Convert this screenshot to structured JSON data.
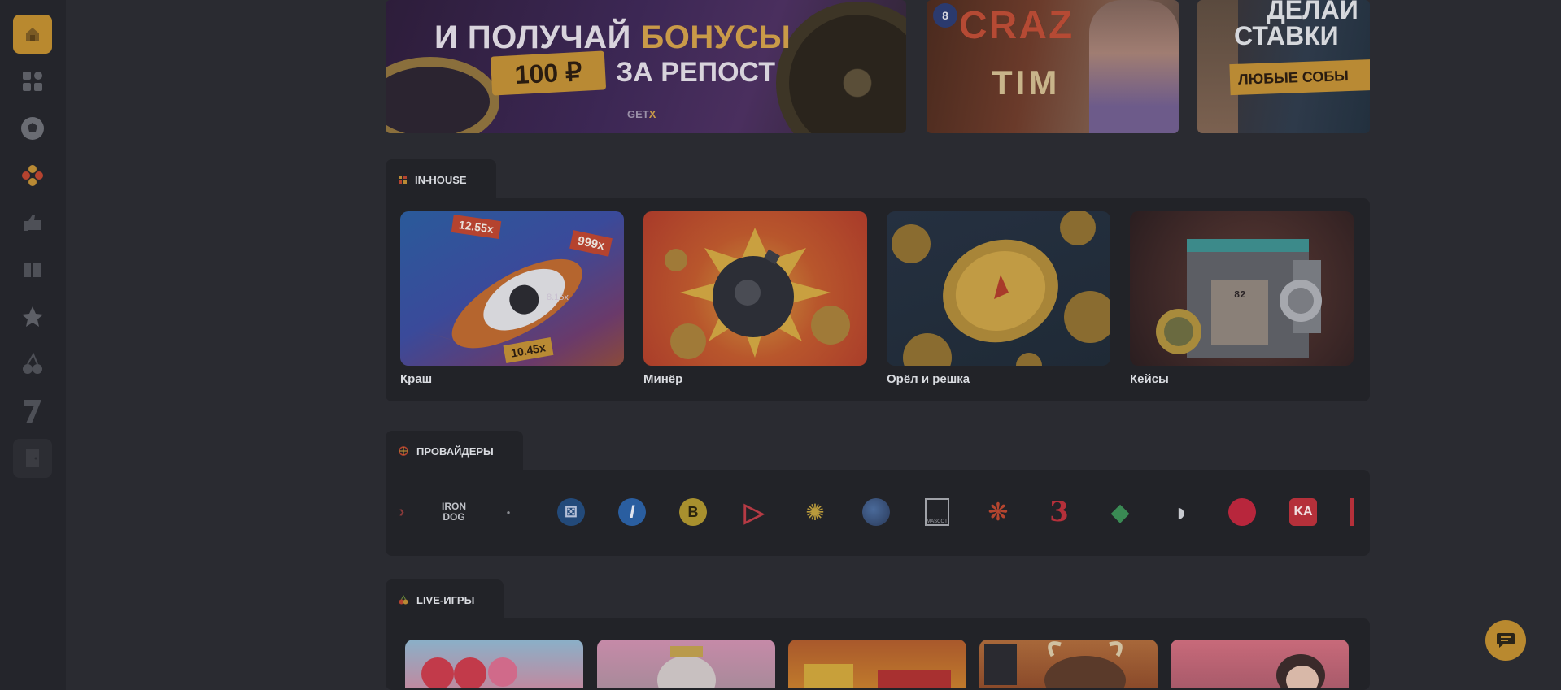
{
  "sidebar": {
    "items": [
      {
        "name": "home",
        "icon": "home-icon"
      },
      {
        "name": "categories",
        "icon": "grid-icon"
      },
      {
        "name": "sports",
        "icon": "soccer-ball-icon"
      },
      {
        "name": "games",
        "icon": "flower-icon"
      },
      {
        "name": "popular",
        "icon": "thumbs-up-icon"
      },
      {
        "name": "book",
        "icon": "book-icon"
      },
      {
        "name": "favorites",
        "icon": "star-icon"
      },
      {
        "name": "slots",
        "icon": "cherries-icon"
      },
      {
        "name": "sevens",
        "icon": "seven-icon"
      },
      {
        "name": "exit",
        "icon": "door-icon"
      }
    ]
  },
  "banners": {
    "promo1": {
      "line1_white": "И ПОЛУЧАЙ ",
      "line1_accent": "БОНУСЫ",
      "amount": "100 ₽",
      "line2": "ЗА РЕПОСТ",
      "brand_main": "GET",
      "brand_accent": "X"
    },
    "promo2": {
      "title": "CRAZ",
      "subtitle": "TIM",
      "ball": "8"
    },
    "promo3": {
      "line1": "ДЕЛАЙ",
      "line2": "СТАВКИ",
      "tag": "ЛЮБЫЕ СОБЫ"
    }
  },
  "inhouse": {
    "title": "IN-HOUSE",
    "games": [
      {
        "label": "Краш",
        "tags": [
          "12.55x",
          "999x",
          "8.15x",
          "10.45x"
        ]
      },
      {
        "label": "Минёр"
      },
      {
        "label": "Орёл и решка"
      },
      {
        "label": "Кейсы",
        "counter": "82"
      }
    ]
  },
  "providers": {
    "title": "ПРОВАЙДЕРЫ",
    "logos": [
      {
        "name": "partial-left",
        "text": "›"
      },
      {
        "name": "iron-dog",
        "text": "IRON DOG"
      },
      {
        "name": "small-logo",
        "text": "●"
      },
      {
        "name": "dice",
        "text": "⚄"
      },
      {
        "name": "i-logo",
        "text": "I"
      },
      {
        "name": "b-logo",
        "text": "B"
      },
      {
        "name": "play-logo",
        "text": "▷"
      },
      {
        "name": "sun-logo",
        "text": "✺"
      },
      {
        "name": "globe-logo",
        "text": "●"
      },
      {
        "name": "mascot",
        "text": "MASCOT"
      },
      {
        "name": "tree-logo",
        "text": "❋"
      },
      {
        "name": "three-logo",
        "text": "3"
      },
      {
        "name": "diamond-logo",
        "text": "◆"
      },
      {
        "name": "pac-logo",
        "text": "◗"
      },
      {
        "name": "red-dot",
        "text": ""
      },
      {
        "name": "ka-logo",
        "text": "KA"
      },
      {
        "name": "partial-right",
        "text": ""
      }
    ]
  },
  "live": {
    "title": "LIVE-ИГРЫ"
  },
  "chat": {
    "icon": "chat-icon"
  },
  "colors": {
    "accent": "#b9892f",
    "background": "#2a2b31",
    "panel": "#222328",
    "sidebar": "#24252b"
  }
}
